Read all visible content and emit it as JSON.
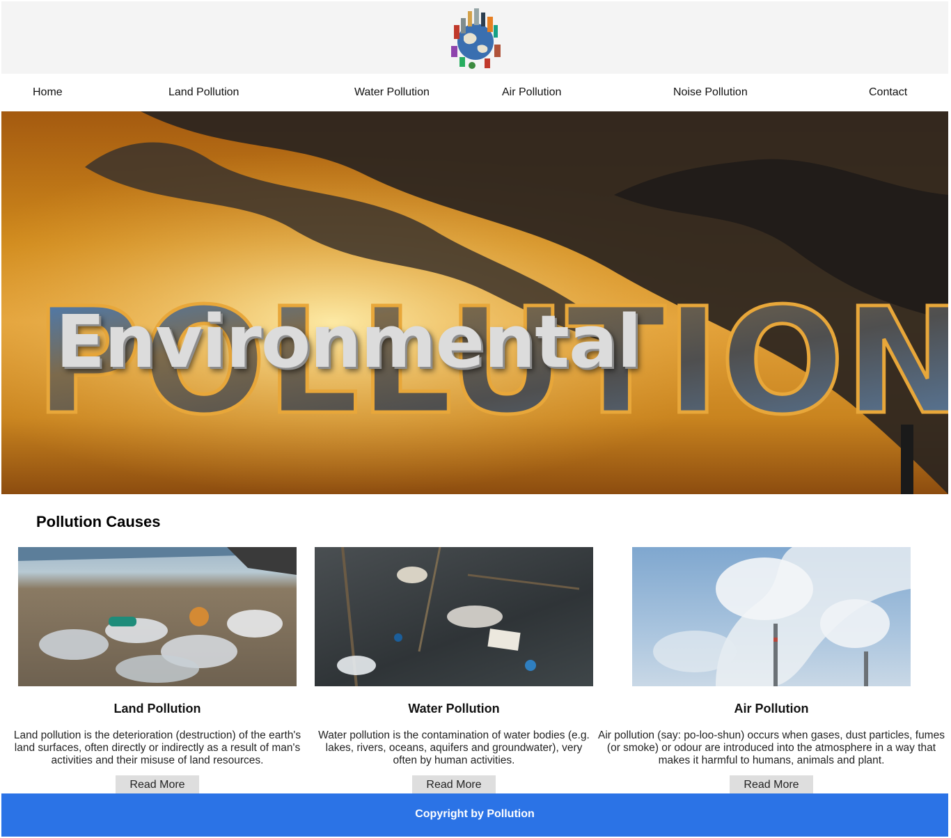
{
  "header": {
    "logo_name": "globe-city-logo"
  },
  "nav": {
    "items": [
      {
        "label": "Home"
      },
      {
        "label": "Land Pollution"
      },
      {
        "label": "Water Pollution"
      },
      {
        "label": "Air Pollution"
      },
      {
        "label": "Noise Pollution"
      },
      {
        "label": "Contact"
      }
    ]
  },
  "hero": {
    "line1": "Environmental",
    "line2": "POLLUTION"
  },
  "section": {
    "title": "Pollution Causes"
  },
  "cards": [
    {
      "title": "Land Pollution",
      "description": "Land pollution is the deterioration (destruction) of the earth's land surfaces, often directly or indirectly as a result of man's activities and their misuse of land resources.",
      "button": "Read More"
    },
    {
      "title": "Water Pollution",
      "description": "Water pollution is the contamination of water bodies (e.g. lakes, rivers, oceans, aquifers and groundwater), very often by human activities.",
      "button": "Read More"
    },
    {
      "title": "Air Pollution",
      "description": "Air pollution (say: po-loo-shun) occurs when gases, dust particles, fumes (or smoke) or odour are introduced into the atmosphere in a way that makes it harmful to humans, animals and plant.",
      "button": "Read More"
    }
  ],
  "footer": {
    "text": "Copyright by Pollution"
  },
  "colors": {
    "footer": "#2b73e6",
    "button": "#dedede",
    "header": "#f4f4f4"
  }
}
